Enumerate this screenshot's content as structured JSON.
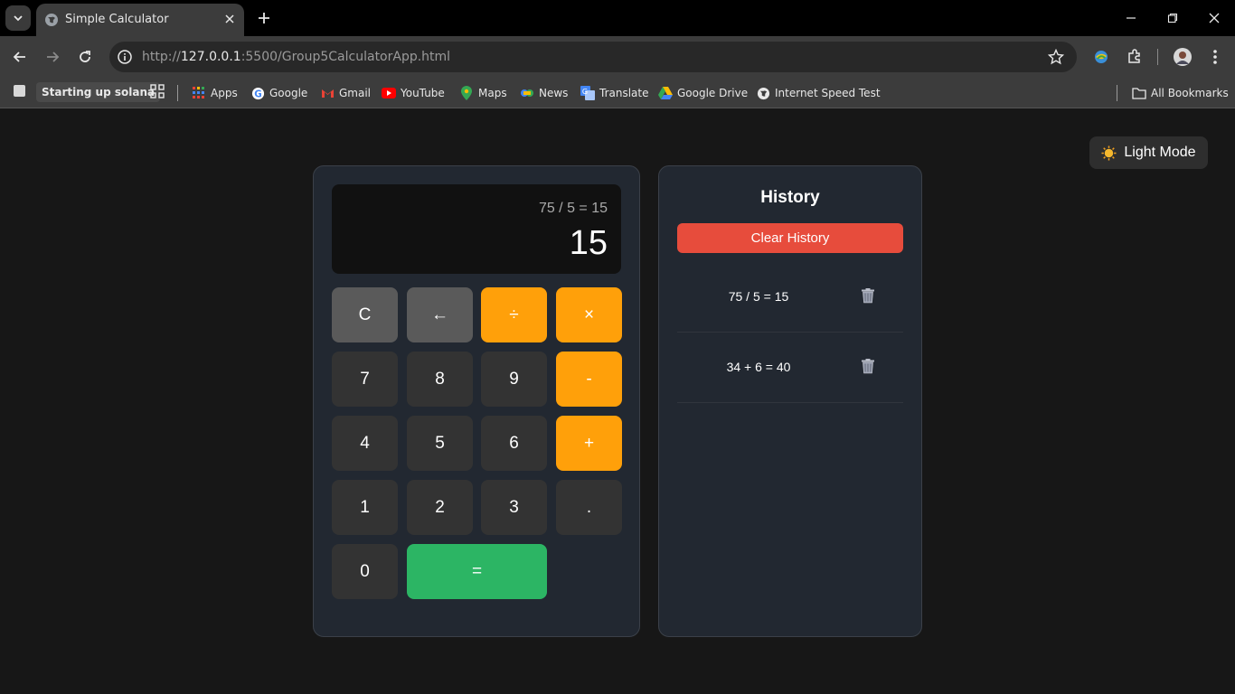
{
  "browser": {
    "tab_title": "Simple Calculator",
    "url_scheme": "http://",
    "url_host": "127.0.0.1",
    "url_rest": ":5500/Group5CalculatorApp.html",
    "bookmarks": {
      "chip": "Starting up solana",
      "items": [
        "Apps",
        "Google",
        "Gmail",
        "YouTube",
        "Maps",
        "News",
        "Translate",
        "Google Drive",
        "Internet Speed Test"
      ],
      "all_bookmarks": "All Bookmarks"
    }
  },
  "page": {
    "mode_button": "Light Mode",
    "display": {
      "expression": "75 / 5 = 15",
      "value": "15"
    },
    "keys": {
      "clear": "C",
      "backspace": "←",
      "divide": "÷",
      "multiply": "×",
      "seven": "7",
      "eight": "8",
      "nine": "9",
      "minus": "-",
      "four": "4",
      "five": "5",
      "six": "6",
      "plus": "+",
      "one": "1",
      "two": "2",
      "three": "3",
      "dot": ".",
      "zero": "0",
      "equals": "="
    },
    "history": {
      "title": "History",
      "clear_label": "Clear History",
      "items": [
        "75 / 5 = 15",
        "34 + 6 = 40"
      ]
    }
  },
  "colors": {
    "accent_operator": "#ffa00a",
    "equals": "#2cb564",
    "clear_history": "#e74c3c",
    "panel": "#222831",
    "background": "#171717"
  }
}
